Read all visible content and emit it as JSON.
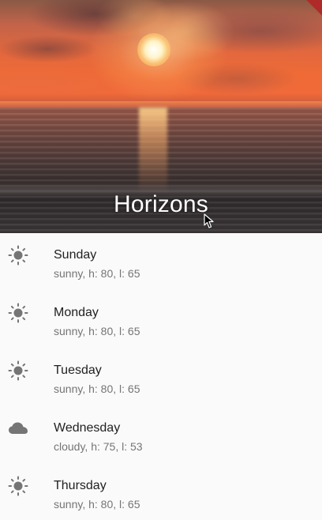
{
  "header": {
    "title": "Horizons",
    "image": "sunset-over-sea"
  },
  "colors": {
    "list_background": "#fafafa",
    "primary_text": "#212121",
    "secondary_text": "#757575",
    "icon": "#757575",
    "title_text": "#ffffff"
  },
  "forecast": [
    {
      "day": "Sunday",
      "icon": "sun-icon",
      "summary": "sunny, h: 80, l: 65"
    },
    {
      "day": "Monday",
      "icon": "sun-icon",
      "summary": "sunny, h: 80, l: 65"
    },
    {
      "day": "Tuesday",
      "icon": "sun-icon",
      "summary": "sunny, h: 80, l: 65"
    },
    {
      "day": "Wednesday",
      "icon": "cloud-icon",
      "summary": "cloudy, h: 75, l: 53"
    },
    {
      "day": "Thursday",
      "icon": "sun-icon",
      "summary": "sunny, h: 80, l: 65"
    }
  ]
}
